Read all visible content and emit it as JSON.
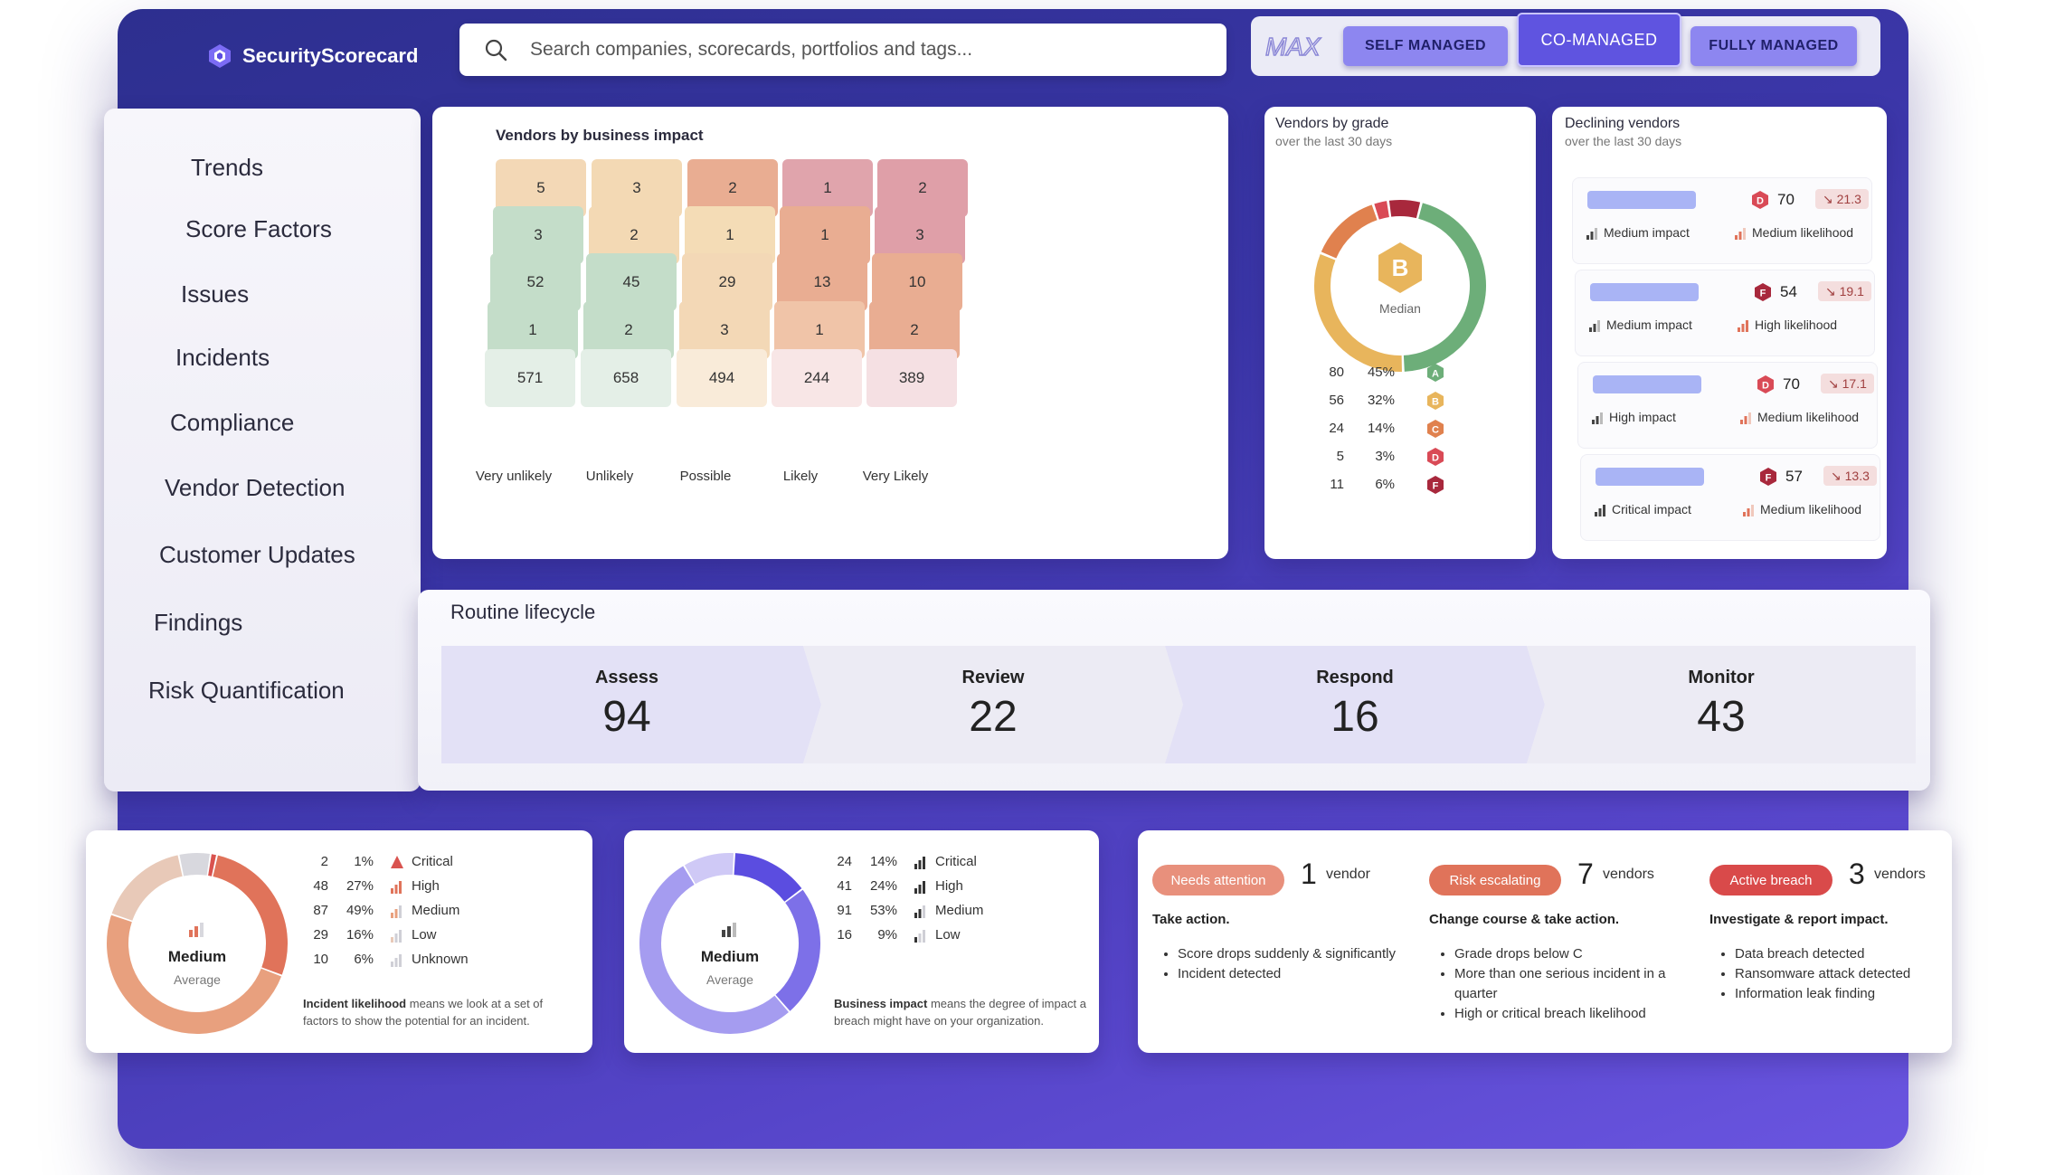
{
  "app": {
    "name": "SecurityScorecard"
  },
  "search": {
    "placeholder": "Search companies, scorecards, portfolios and tags..."
  },
  "modes": {
    "logo_text": "MAX",
    "self_managed": "SELF MANAGED",
    "co_managed": "CO-MANAGED",
    "fully_managed": "FULLY MANAGED",
    "active": "CO-MANAGED"
  },
  "sidebar": {
    "items": [
      {
        "label": "Trends"
      },
      {
        "label": "Score Factors"
      },
      {
        "label": "Issues"
      },
      {
        "label": "Incidents"
      },
      {
        "label": "Compliance"
      },
      {
        "label": "Vendor Detection"
      },
      {
        "label": "Customer Updates"
      },
      {
        "label": "Findings"
      },
      {
        "label": "Risk Quantification"
      }
    ]
  },
  "business_impact": {
    "title": "Vendors by business impact",
    "columns": [
      "Very unlikely",
      "Unlikely",
      "Possible",
      "Likely",
      "Very Likely"
    ],
    "rows": [
      {
        "values": [
          "5",
          "3",
          "2",
          "1",
          "2"
        ],
        "colors": [
          "#f3d8b6",
          "#f3d9b4",
          "#e9ad92",
          "#e0a4ac",
          "#df9fa8"
        ]
      },
      {
        "values": [
          "3",
          "2",
          "1",
          "1",
          "3"
        ],
        "colors": [
          "#c4ddc9",
          "#f3d9b4",
          "#f4dcb6",
          "#e9ad92",
          "#df9fa8"
        ]
      },
      {
        "values": [
          "52",
          "45",
          "29",
          "13",
          "10"
        ],
        "colors": [
          "#c4ddc9",
          "#c4ddc9",
          "#f3d8b6",
          "#e9ad92",
          "#e9ad92"
        ]
      },
      {
        "values": [
          "1",
          "2",
          "3",
          "1",
          "2"
        ],
        "colors": [
          "#c4ddc9",
          "#c4ddc9",
          "#f3d8b6",
          "#f0c4a8",
          "#e9ad92"
        ]
      },
      {
        "values": [
          "571",
          "658",
          "494",
          "244",
          "389"
        ],
        "colors": [
          "#e4efe7",
          "#e4efe7",
          "#f9ebd9",
          "#f8e6e6",
          "#f5e0e3"
        ]
      }
    ]
  },
  "vendors_by_grade": {
    "title": "Vendors by grade",
    "subtitle": "over the last 30 days",
    "median_grade": "B",
    "median_label": "Median",
    "grades": [
      {
        "count": "80",
        "pct": "45%",
        "grade": "A",
        "color": "#6dae79"
      },
      {
        "count": "56",
        "pct": "32%",
        "grade": "B",
        "color": "#e8b55c"
      },
      {
        "count": "24",
        "pct": "14%",
        "grade": "C",
        "color": "#e0814e"
      },
      {
        "count": "5",
        "pct": "3%",
        "grade": "D",
        "color": "#d94a56"
      },
      {
        "count": "11",
        "pct": "6%",
        "grade": "F",
        "color": "#a8283c"
      }
    ]
  },
  "declining_vendors": {
    "title": "Declining vendors",
    "subtitle": "over the last 30 days",
    "items": [
      {
        "grade": "D",
        "score": "70",
        "change": "↘ 21.3",
        "impact": "Medium impact",
        "likelihood": "Medium likelihood",
        "grade_color": "#d94a56"
      },
      {
        "grade": "F",
        "score": "54",
        "change": "↘ 19.1",
        "impact": "Medium impact",
        "likelihood": "High likelihood",
        "grade_color": "#a8283c"
      },
      {
        "grade": "D",
        "score": "70",
        "change": "↘ 17.1",
        "impact": "High impact",
        "likelihood": "Medium likelihood",
        "grade_color": "#d94a56"
      },
      {
        "grade": "F",
        "score": "57",
        "change": "↘ 13.3",
        "impact": "Critical impact",
        "likelihood": "Medium likelihood",
        "grade_color": "#a8283c"
      }
    ]
  },
  "routine_lifecycle": {
    "title": "Routine lifecycle",
    "stages": [
      {
        "name": "Assess",
        "value": "94"
      },
      {
        "name": "Review",
        "value": "22"
      },
      {
        "name": "Respond",
        "value": "16"
      },
      {
        "name": "Monitor",
        "value": "43"
      }
    ]
  },
  "incident_likelihood": {
    "center_label": "Medium",
    "center_sub": "Average",
    "rows": [
      {
        "count": "2",
        "pct": "1%",
        "label": "Critical",
        "color": "#d9534f"
      },
      {
        "count": "48",
        "pct": "27%",
        "label": "High",
        "color": "#e0735a"
      },
      {
        "count": "87",
        "pct": "49%",
        "label": "Medium",
        "color": "#e8a07e"
      },
      {
        "count": "29",
        "pct": "16%",
        "label": "Low",
        "color": "#e8c9b8"
      },
      {
        "count": "10",
        "pct": "6%",
        "label": "Unknown",
        "color": "#d8d8de"
      }
    ],
    "note_bold": "Incident likelihood",
    "note_rest": " means we look at a set of factors to show the potential for an incident."
  },
  "business_impact_summary": {
    "center_label": "Medium",
    "center_sub": "Average",
    "rows": [
      {
        "count": "24",
        "pct": "14%",
        "label": "Critical",
        "color": "#5b4de0"
      },
      {
        "count": "41",
        "pct": "24%",
        "label": "High",
        "color": "#7d70e8"
      },
      {
        "count": "91",
        "pct": "53%",
        "label": "Medium",
        "color": "#a59cf0"
      },
      {
        "count": "16",
        "pct": "9%",
        "label": "Low",
        "color": "#cfc9f6"
      }
    ],
    "note_bold": "Business impact",
    "note_rest": " means the degree of impact a breach might have on your organization."
  },
  "status_groups": [
    {
      "pill": "Needs attention",
      "pill_color": "#e8907c",
      "count": "1",
      "unit": "vendor",
      "heading": "Take action.",
      "bullets": [
        "Score drops suddenly & significantly",
        "Incident detected"
      ]
    },
    {
      "pill": "Risk escalating",
      "pill_color": "#e0735a",
      "count": "7",
      "unit": "vendors",
      "heading": "Change course & take action.",
      "bullets": [
        "Grade drops below C",
        "More than one serious incident in a quarter",
        "High or critical breach likelihood"
      ]
    },
    {
      "pill": "Active breach",
      "pill_color": "#d94a4a",
      "count": "3",
      "unit": "vendors",
      "heading": "Investigate & report impact.",
      "bullets": [
        "Data breach detected",
        "Ransomware attack detected",
        "Information leak finding"
      ]
    }
  ]
}
